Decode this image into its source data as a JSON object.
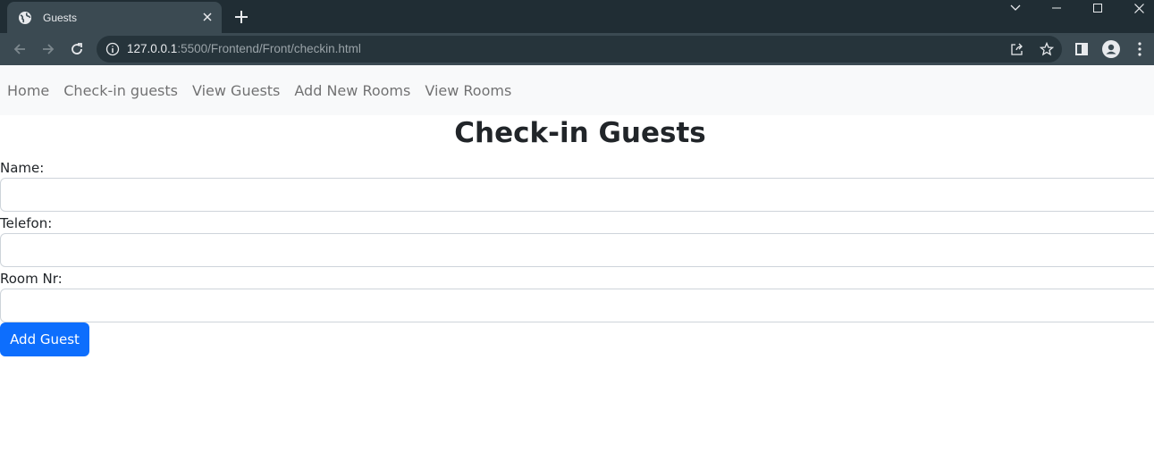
{
  "browser": {
    "tab_title": "Guests",
    "url_host": "127.0.0.1",
    "url_rest": ":5500/Frontend/Front/checkin.html"
  },
  "icons": {
    "tab": "globe-icon",
    "tab_close": "close-icon",
    "new_tab": "plus-icon",
    "back": "back-arrow-icon",
    "forward": "forward-arrow-icon",
    "reload": "reload-icon",
    "site_info": "info-icon",
    "share": "share-icon",
    "bookmark": "star-icon",
    "side_panel": "side-panel-icon",
    "profile": "profile-icon",
    "menu": "kebab-menu-icon"
  },
  "nav": {
    "links": [
      {
        "label": "Home"
      },
      {
        "label": "Check-in guests"
      },
      {
        "label": "View Guests"
      },
      {
        "label": "Add New Rooms"
      },
      {
        "label": "View Rooms"
      }
    ]
  },
  "page": {
    "title": "Check-in Guests"
  },
  "form": {
    "name_label": "Name:",
    "name_value": "",
    "telefon_label": "Telefon:",
    "telefon_value": "",
    "room_label": "Room Nr:",
    "room_value": "",
    "submit_label": "Add Guest"
  },
  "colors": {
    "chrome_dark": "#202d34",
    "chrome_toolbar": "#3b4a52",
    "navbar_bg": "#f8f9fa",
    "primary": "#0d6efd"
  }
}
